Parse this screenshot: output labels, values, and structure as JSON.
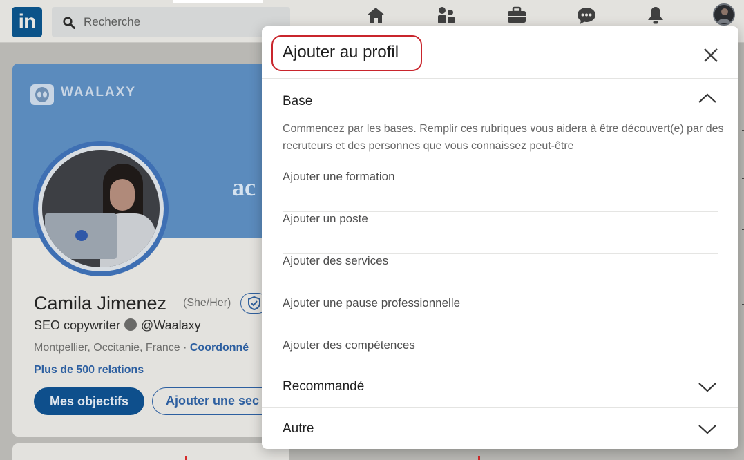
{
  "topbar": {
    "logo_text": "in",
    "search_placeholder": "Recherche",
    "nav_icons": [
      "home-icon",
      "network-icon",
      "jobs-icon",
      "messaging-icon",
      "notifications-icon",
      "me-avatar"
    ]
  },
  "profile": {
    "banner_brand": "WAALAXY",
    "banner_fragment": "ac",
    "name": "Camila Jimenez",
    "pronouns": "(She/Her)",
    "headline_prefix": "SEO copywriter",
    "headline_suffix": "@Waalaxy",
    "location": "Montpellier, Occitanie, France · ",
    "contact_link": "Coordonné",
    "relations": "Plus de 500 relations",
    "primary_button": "Mes objectifs",
    "secondary_button": "Ajouter une sec"
  },
  "modal": {
    "title": "Ajouter au profil",
    "sections": [
      {
        "label": "Base",
        "expanded": true,
        "description": "Commencez par les bases. Remplir ces rubriques vous aidera à être découvert(e) par des recruteurs et des personnes que vous connaissez peut-être",
        "items": [
          "Ajouter une formation",
          "Ajouter un poste",
          "Ajouter des services",
          "Ajouter une pause professionnelle",
          "Ajouter des compétences"
        ]
      },
      {
        "label": "Recommandé",
        "expanded": false
      },
      {
        "label": "Autre",
        "expanded": false
      }
    ]
  },
  "colors": {
    "linkedin_blue": "#0a66c2",
    "highlight_red": "#c9252c",
    "overlay": "#b9b8b4"
  }
}
